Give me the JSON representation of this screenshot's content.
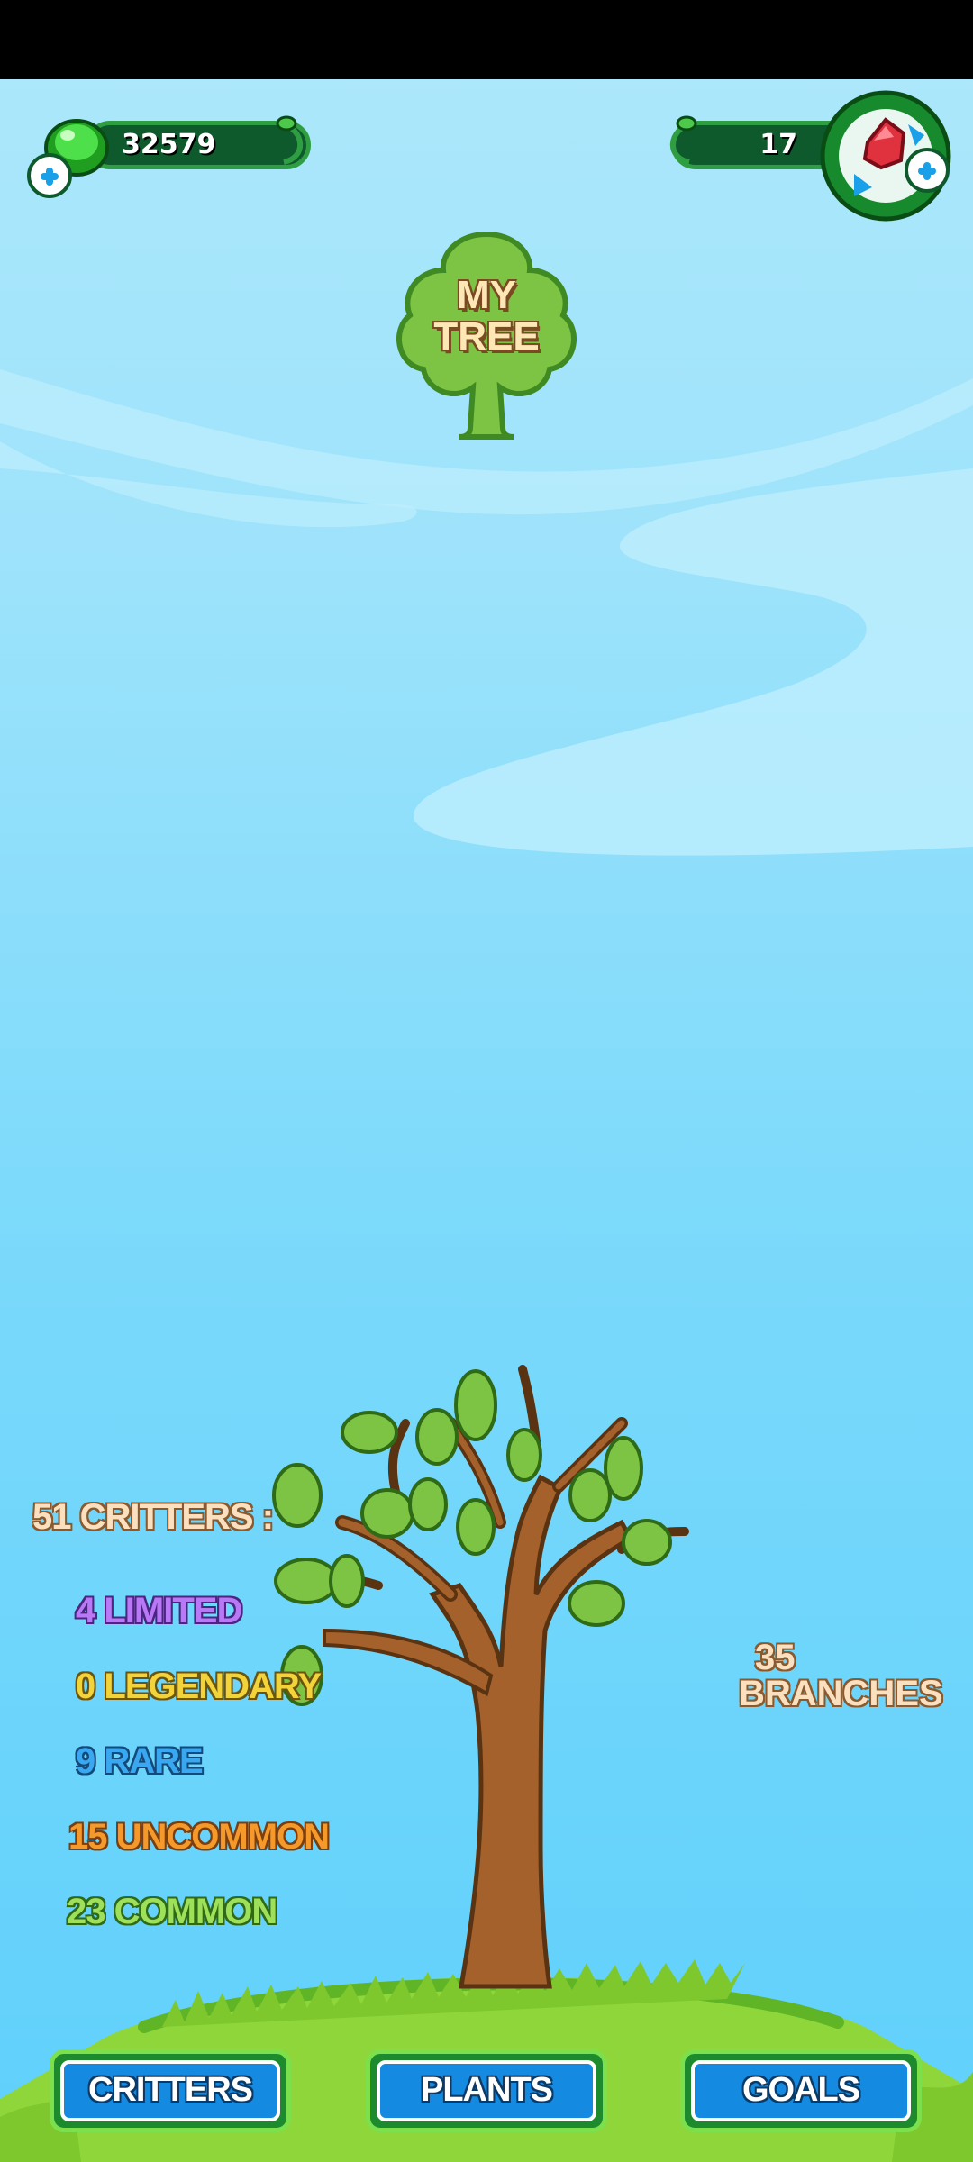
{
  "resources": {
    "coins": "32579",
    "gems": "17"
  },
  "title": "MY\nTREE",
  "critters": {
    "total": "51 CRITTERS :",
    "limited": "4 LIMITED",
    "legendary": "0 LEGENDARY",
    "rare": "9 RARE",
    "uncommon": "15 UNCOMMON",
    "common": "23 COMMON"
  },
  "branches": {
    "count": "35",
    "label": "BRANCHES"
  },
  "nav": {
    "critters": "CRITTERS",
    "plants": "PLANTS",
    "goals": "GOALS"
  },
  "colors": {
    "limited": "#b978f5",
    "legendary": "#f2d33a",
    "rare": "#3aa8f0",
    "uncommon": "#f59a2a",
    "common": "#9ee05a"
  },
  "icons": [
    "green-gem-icon",
    "red-gem-icon",
    "plus-icon",
    "tree-icon"
  ]
}
